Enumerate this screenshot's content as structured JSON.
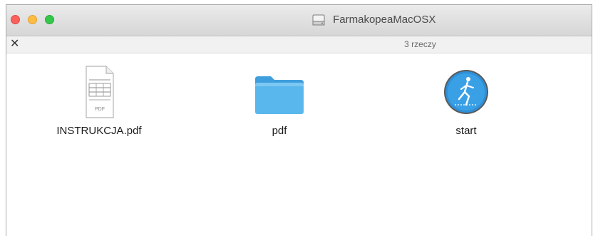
{
  "window": {
    "title": "FarmakopeaMacOSX",
    "item_count": "3 rzeczy"
  },
  "items": [
    {
      "label": "INSTRUKCJA.pdf",
      "icon": "pdf-document-icon"
    },
    {
      "label": "pdf",
      "icon": "folder-icon"
    },
    {
      "label": "start",
      "icon": "app-icon"
    }
  ],
  "colors": {
    "close": "#fc605b",
    "minimize": "#fdbc40",
    "zoom": "#34c84a",
    "folder": "#5ab7ee",
    "app_circle": "#2f8fd6"
  }
}
